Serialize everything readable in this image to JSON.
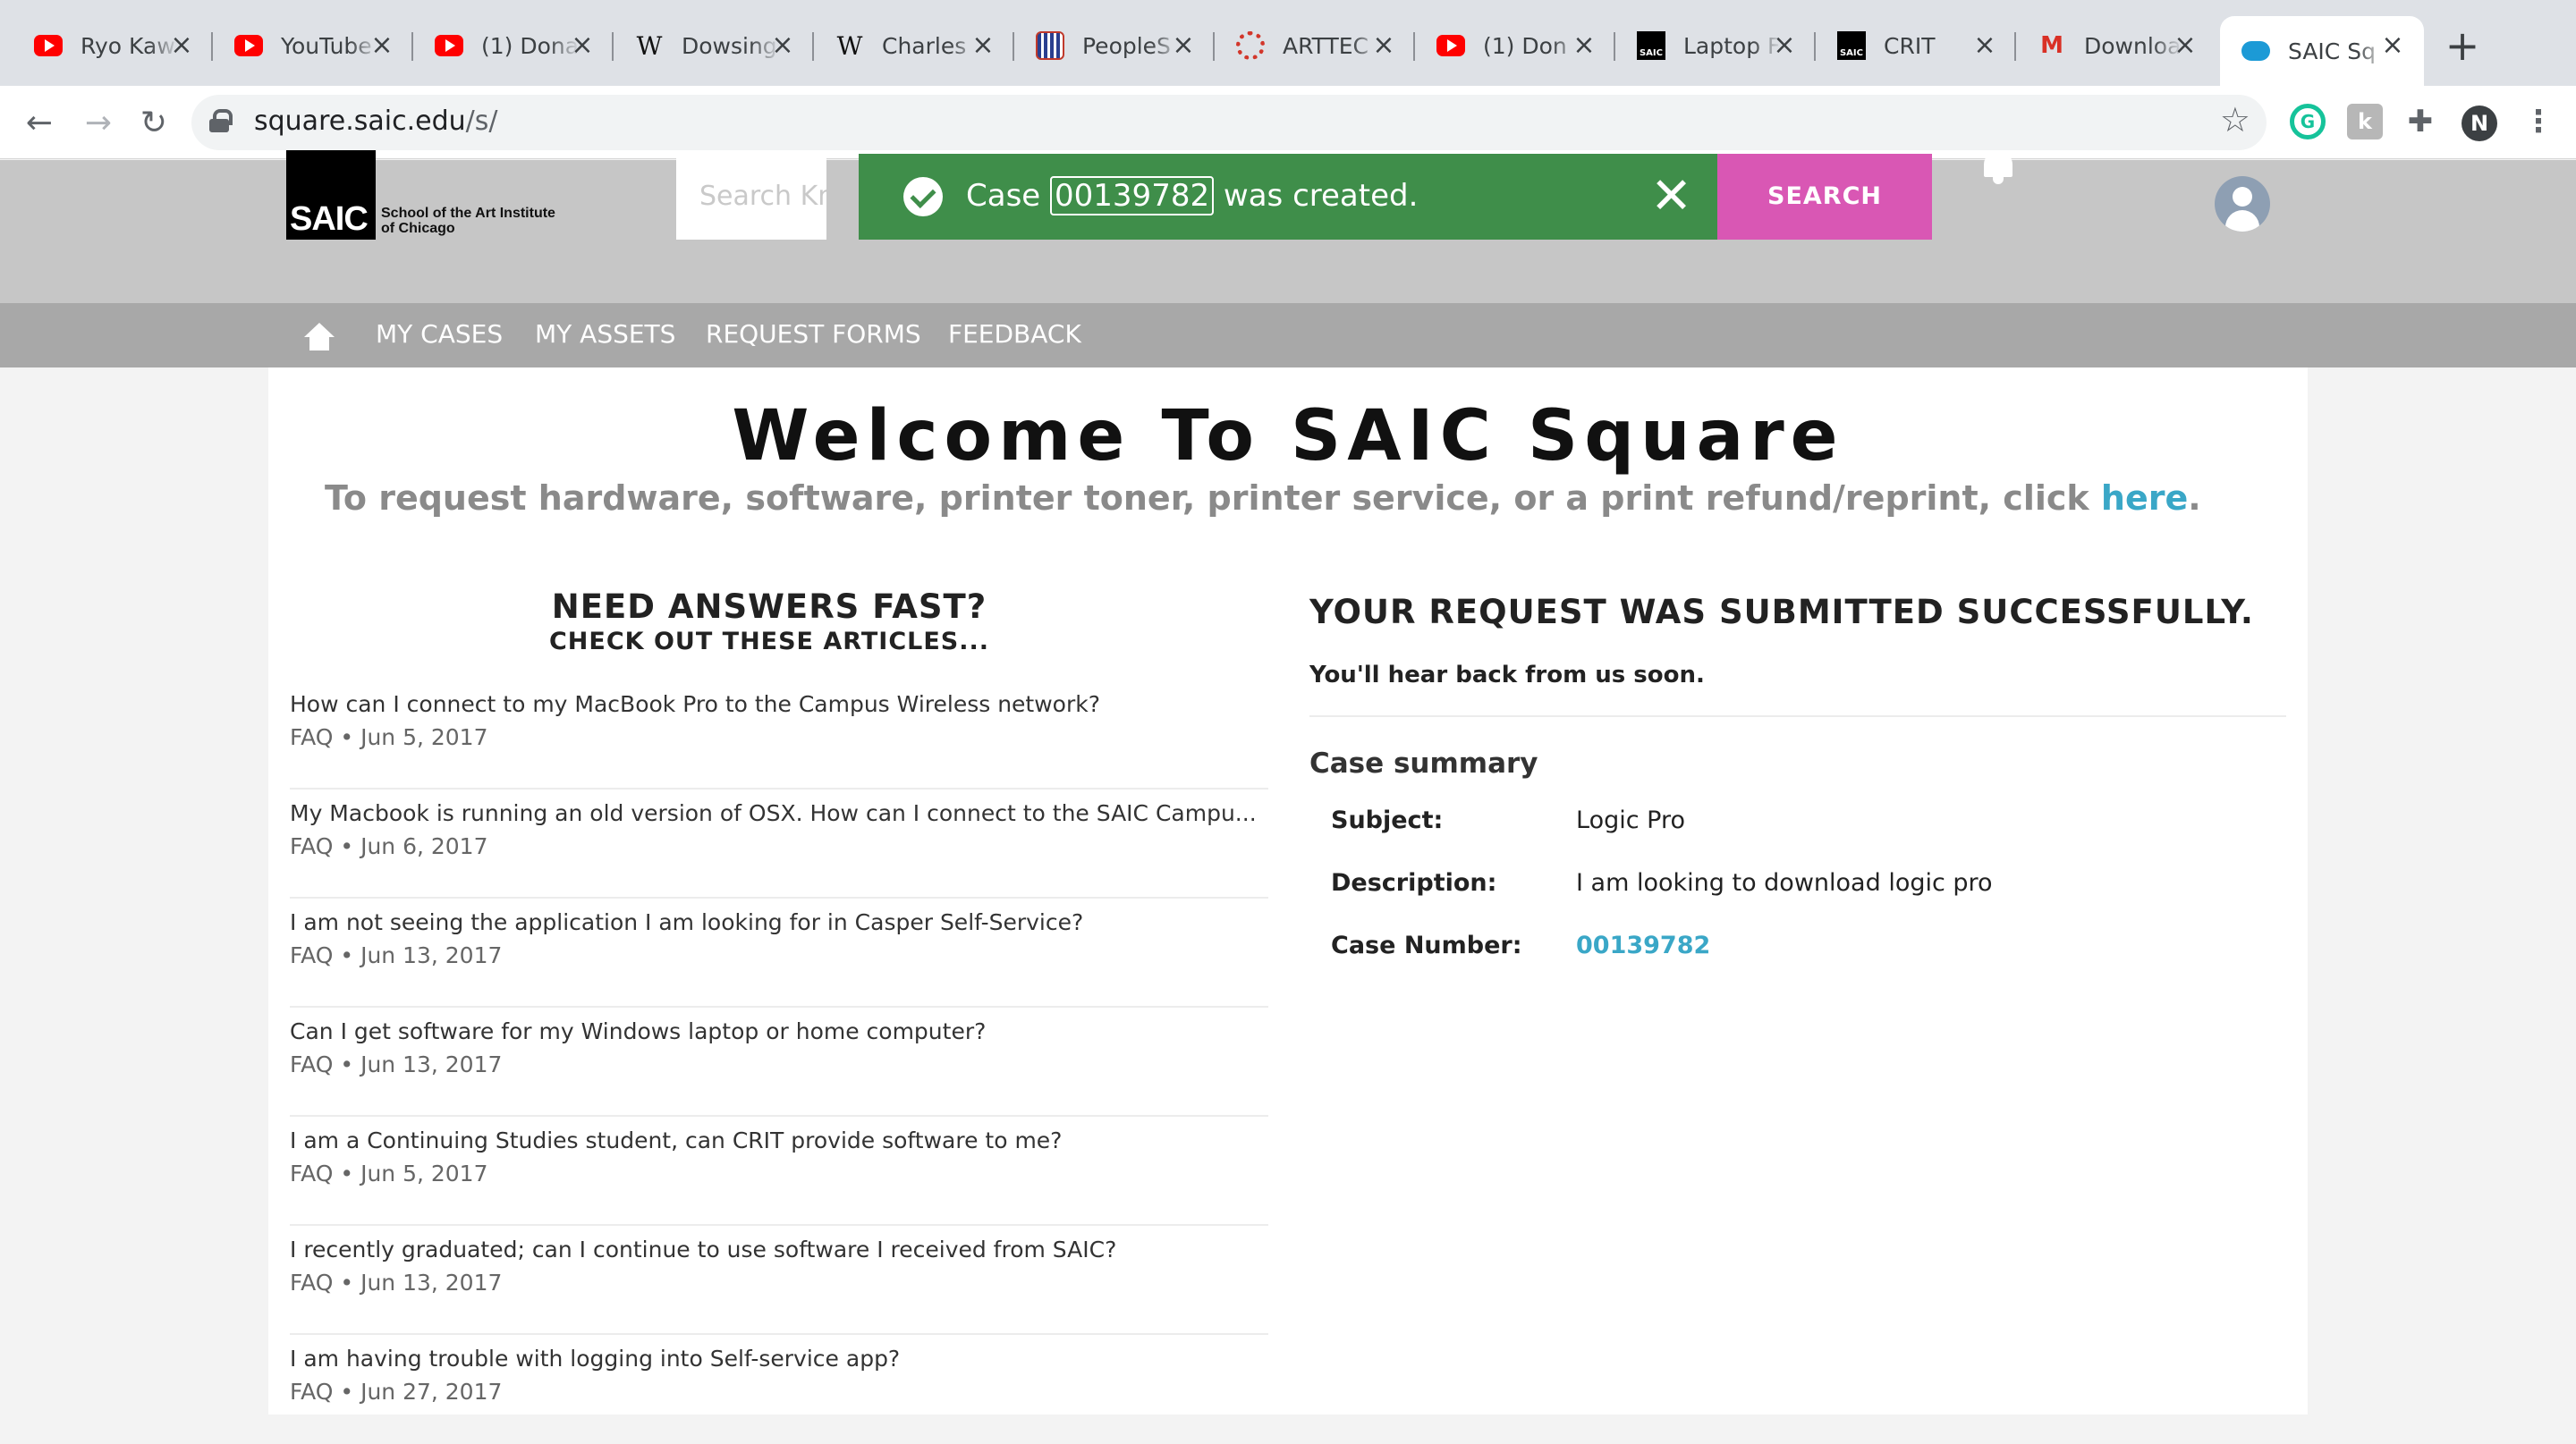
{
  "browser": {
    "tabs": [
      {
        "title": "Ryo Kaw",
        "icon": "youtube-icon"
      },
      {
        "title": "YouTube",
        "icon": "youtube-icon"
      },
      {
        "title": "(1) Dona",
        "icon": "youtube-icon"
      },
      {
        "title": "Dowsing",
        "icon": "wikipedia-icon"
      },
      {
        "title": "Charles",
        "icon": "wikipedia-icon"
      },
      {
        "title": "PeopleS",
        "icon": "peoplesoft-icon"
      },
      {
        "title": "ARTTEC",
        "icon": "arttec-icon"
      },
      {
        "title": "(1) Don",
        "icon": "youtube-icon"
      },
      {
        "title": "Laptop F",
        "icon": "saic-icon"
      },
      {
        "title": "CRIT",
        "icon": "saic-icon"
      },
      {
        "title": "Downloa",
        "icon": "gmail-icon"
      },
      {
        "title": "SAIC Sq",
        "icon": "salesforce-cloud-icon"
      }
    ],
    "url_host": "square.saic.edu",
    "url_path": "/s/",
    "profile_initial": "N"
  },
  "site": {
    "logo_mark": "SAIC",
    "logo_line1": "School of the Art Institute",
    "logo_line2": "of Chicago",
    "search_placeholder": "Search Knov",
    "search_button": "SEARCH",
    "nav": [
      "MY CASES",
      "MY ASSETS",
      "REQUEST FORMS",
      "FEEDBACK"
    ]
  },
  "toast": {
    "prefix": "Case",
    "case_number": "00139782",
    "suffix": "was created."
  },
  "welcome": {
    "title": "Welcome To SAIC Square",
    "subtitle": "To request hardware, software, printer toner, printer service, or a print refund/reprint, click",
    "link": "here",
    "period": "."
  },
  "faq": {
    "heading": "NEED ANSWERS FAST?",
    "subheading": "CHECK OUT THESE ARTICLES...",
    "articles": [
      {
        "title": "How can I connect to my MacBook Pro to the Campus Wireless network?",
        "meta": "FAQ  •  Jun 5, 2017"
      },
      {
        "title": "My Macbook is running an old version of OSX. How can I connect to the SAIC Campu...",
        "meta": "FAQ  •  Jun 6, 2017"
      },
      {
        "title": "I am not seeing the application I am looking for in Casper Self-Service?",
        "meta": "FAQ  •  Jun 13, 2017"
      },
      {
        "title": "Can I get software for my Windows laptop or home computer?",
        "meta": "FAQ  •  Jun 13, 2017"
      },
      {
        "title": "I am a Continuing Studies student, can CRIT provide software to me?",
        "meta": "FAQ  •  Jun 5, 2017"
      },
      {
        "title": "I recently graduated; can I continue to use software I received from SAIC?",
        "meta": "FAQ  •  Jun 13, 2017"
      },
      {
        "title": "I am having trouble with logging into Self-service app?",
        "meta": "FAQ  •  Jun 27, 2017"
      }
    ]
  },
  "request": {
    "heading": "YOUR REQUEST WAS SUBMITTED SUCCESSFULLY.",
    "message": "You'll hear back from us soon.",
    "summary_heading": "Case summary",
    "subject_label": "Subject:",
    "subject_value": "Logic Pro",
    "description_label": "Description:",
    "description_value": "I am looking to download logic pro",
    "case_label": "Case Number:",
    "case_value": "00139782"
  },
  "colors": {
    "toast_green": "#3f8e4a",
    "search_pink": "#d957b4",
    "link_teal": "#3aa7c7",
    "header_gray": "#c6c6c6",
    "nav_gray": "#a8a8a8"
  }
}
